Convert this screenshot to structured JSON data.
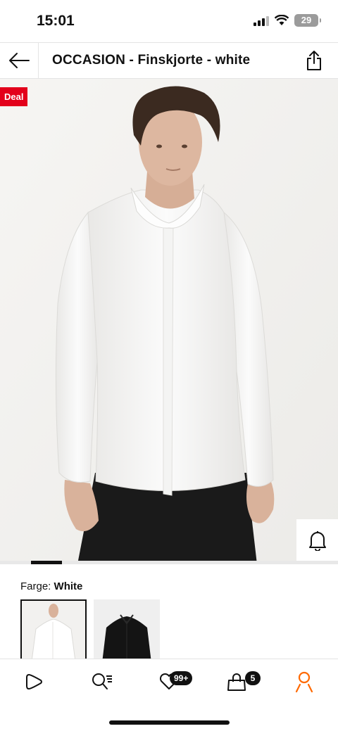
{
  "status": {
    "time": "15:01",
    "battery": "29"
  },
  "header": {
    "title": "OCCASION - Finskjorte - white"
  },
  "product": {
    "deal_label": "Deal",
    "image_index": 2,
    "image_count": 11
  },
  "color": {
    "label": "Farge:",
    "value": "White",
    "swatches": [
      "White",
      "Black"
    ]
  },
  "nav": {
    "wishlist_badge": "99+",
    "bag_badge": "5"
  },
  "colors": {
    "deal": "#e3001b",
    "accent": "#ff6900",
    "dark": "#111111"
  }
}
